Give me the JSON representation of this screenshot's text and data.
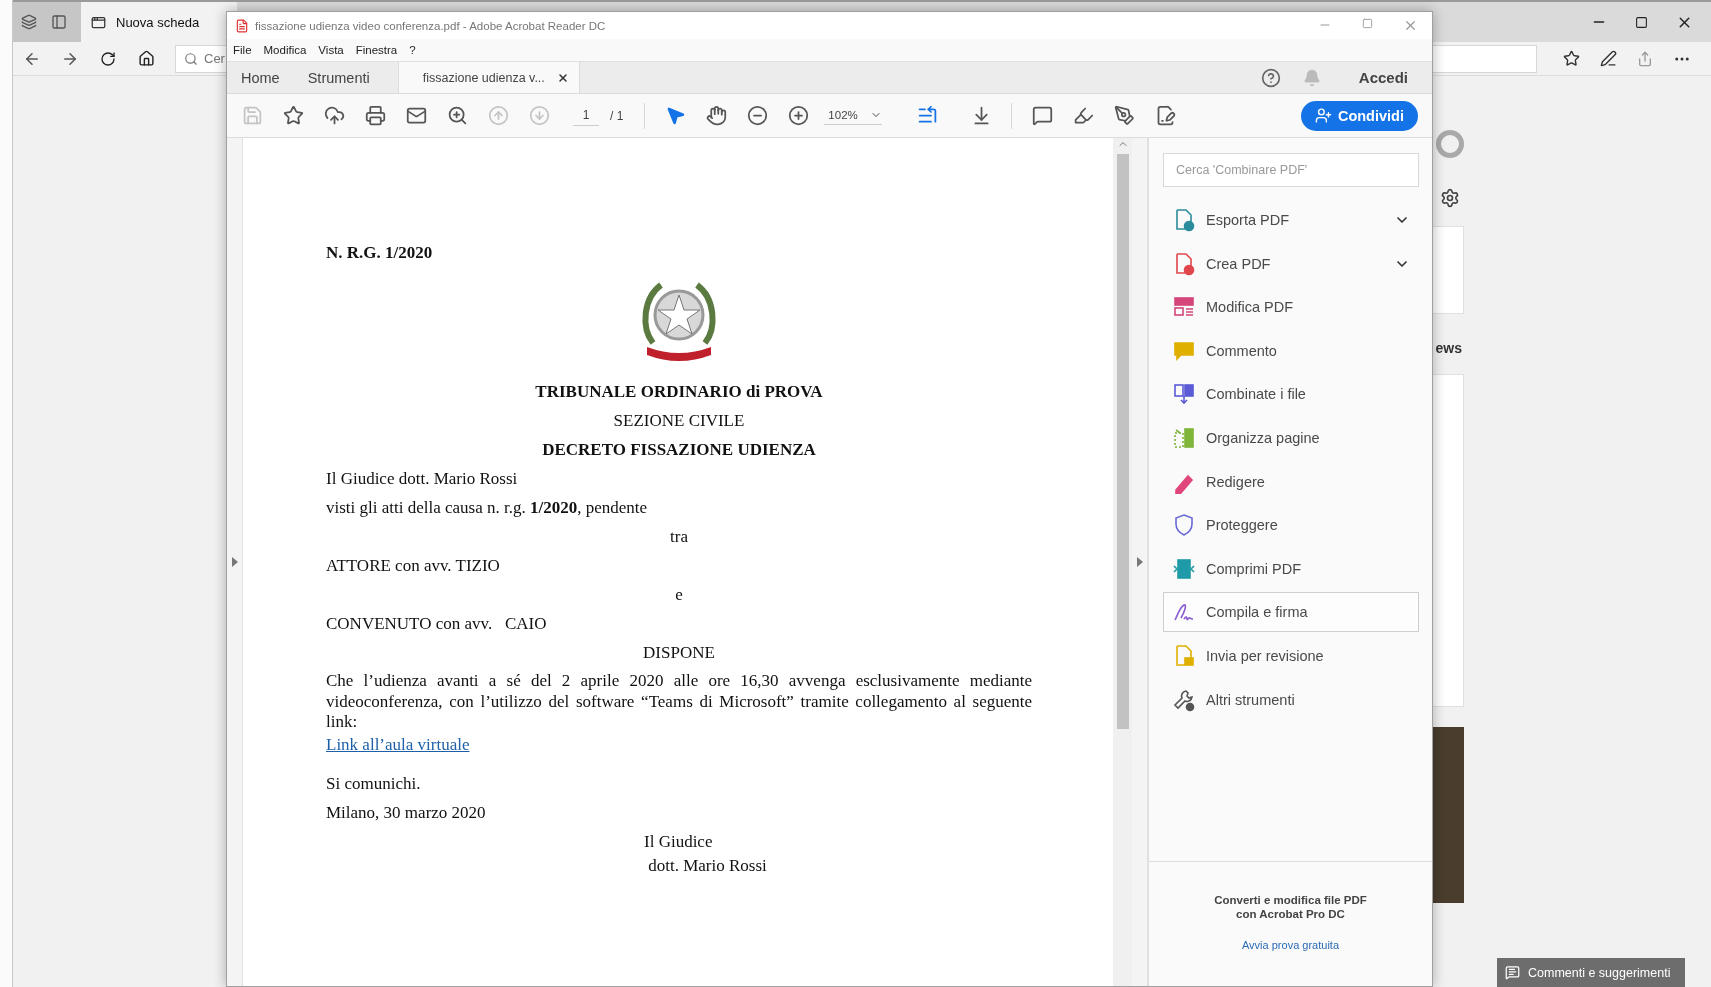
{
  "browser": {
    "tab_title": "Nuova scheda",
    "address_placeholder": "Cer",
    "page_heading_fragment": "ews",
    "feedback_button": "Commenti e suggerimenti"
  },
  "acrobat": {
    "title": "fissazione udienza video conferenza.pdf - Adobe Acrobat Reader DC",
    "menu": [
      "File",
      "Modifica",
      "Vista",
      "Finestra",
      "?"
    ],
    "tabs": [
      {
        "label": "Home",
        "kind": "nav",
        "selected": false
      },
      {
        "label": "Strumenti",
        "kind": "nav",
        "selected": false
      },
      {
        "label": "fissazione udienza v...",
        "kind": "document",
        "selected": true
      }
    ],
    "sign_in": "Accedi",
    "toolbar": {
      "file_buttons": [
        {
          "kind": "save",
          "disabled": true
        },
        {
          "kind": "star",
          "disabled": false
        },
        {
          "kind": "upload",
          "disabled": false
        },
        {
          "kind": "print",
          "disabled": false
        },
        {
          "kind": "mail",
          "disabled": false
        },
        {
          "kind": "search",
          "disabled": false
        },
        {
          "kind": "prev",
          "disabled": true
        },
        {
          "kind": "next",
          "disabled": true
        }
      ],
      "page_current": "1",
      "page_total": "/ 1",
      "view_buttons": [
        {
          "kind": "pointer",
          "selected": true
        },
        {
          "kind": "hand",
          "selected": false
        },
        {
          "kind": "zoom_out",
          "selected": false
        },
        {
          "kind": "zoom_in",
          "selected": false
        }
      ],
      "zoom": "102%",
      "annotate_buttons": [
        {
          "kind": "comment"
        },
        {
          "kind": "highlight"
        },
        {
          "kind": "sign"
        },
        {
          "kind": "edit"
        }
      ],
      "share_button": "Condividi"
    },
    "document": {
      "lines": [
        {
          "kind": "left_line",
          "bold": true,
          "text": "N. R.G. 1/2020"
        },
        {
          "kind": "emblem"
        },
        {
          "kind": "center_line",
          "bold": true,
          "text": "TRIBUNALE ORDINARIO di PROVA"
        },
        {
          "kind": "center_line",
          "bold": false,
          "text": "SEZIONE CIVILE"
        },
        {
          "kind": "center_line",
          "bold": true,
          "text": "DECRETO FISSAZIONE UDIENZA"
        },
        {
          "kind": "left_line",
          "bold": false,
          "text": "Il Giudice dott. Mario Rossi"
        },
        {
          "kind": "left_line",
          "bold": false,
          "text": "visti gli atti della causa n. r.g. **1/2020**, pendente"
        },
        {
          "kind": "center_line",
          "bold": false,
          "text": "tra"
        },
        {
          "kind": "left_line",
          "bold": false,
          "text": "ATTORE con avv. TIZIO"
        },
        {
          "kind": "center_line",
          "bold": false,
          "text": "e"
        },
        {
          "kind": "left_line",
          "bold": false,
          "text": "CONVENUTO con avv.   CAIO"
        },
        {
          "kind": "center_line",
          "bold": false,
          "text": "DISPONE"
        },
        {
          "kind": "paragraph",
          "bold": false,
          "text": "Che l’udienza avanti a sé del 2 aprile 2020 alle ore 16,30 avvenga esclusivamente mediante videoconferenza, con l’utilizzo del software “Teams di Microsoft” tramite collegamento al seguente link:"
        },
        {
          "kind": "link",
          "text": "Link all’aula virtuale"
        },
        {
          "kind": "left_line",
          "bold": false,
          "text": "Si comunichi."
        },
        {
          "kind": "left_line",
          "bold": false,
          "text": "Milano, 30 marzo 2020"
        },
        {
          "kind": "signature",
          "text": "Il Giudice"
        },
        {
          "kind": "signature",
          "text": " dott. Mario Rossi"
        }
      ]
    },
    "tools_pane": {
      "search_placeholder": "Cerca 'Combinare PDF'",
      "tools": [
        {
          "kind": "export",
          "label": "Esporta PDF",
          "color": "#2b8c9b",
          "expandable": true,
          "selected": false
        },
        {
          "kind": "create",
          "label": "Crea PDF",
          "color": "#e0474c",
          "expandable": true,
          "selected": false
        },
        {
          "kind": "edit",
          "label": "Modifica PDF",
          "color": "#d4457a",
          "expandable": false,
          "selected": false
        },
        {
          "kind": "comment",
          "label": "Commento",
          "color": "#e0b000",
          "expandable": false,
          "selected": false
        },
        {
          "kind": "combine",
          "label": "Combinate i file",
          "color": "#5b5bd6",
          "expandable": false,
          "selected": false
        },
        {
          "kind": "organize",
          "label": "Organizza pagine",
          "color": "#7fb539",
          "expandable": false,
          "selected": false
        },
        {
          "kind": "redact",
          "label": "Redigere",
          "color": "#e0457b",
          "expandable": false,
          "selected": false
        },
        {
          "kind": "protect",
          "label": "Proteggere",
          "color": "#6b6bd6",
          "expandable": false,
          "selected": false
        },
        {
          "kind": "compress",
          "label": "Comprimi PDF",
          "color": "#1f9aa8",
          "expandable": false,
          "selected": false
        },
        {
          "kind": "sign",
          "label": "Compila e firma",
          "color": "#8a5bd1",
          "expandable": false,
          "selected": true
        },
        {
          "kind": "review",
          "label": "Invia per revisione",
          "color": "#e0b000",
          "expandable": false,
          "selected": false
        },
        {
          "kind": "more",
          "label": "Altri strumenti",
          "color": "#555555",
          "expandable": false,
          "selected": false
        }
      ],
      "promo_text": "Converti e modifica file PDF\ncon Acrobat Pro DC",
      "promo_link": "Avvia prova gratuita"
    }
  }
}
